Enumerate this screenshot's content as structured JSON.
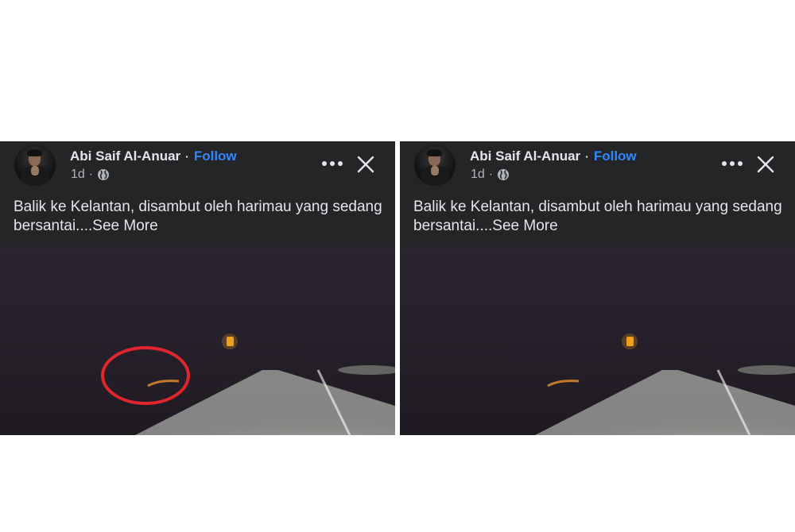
{
  "posts": [
    {
      "author": "Abi Saif Al-Anuar",
      "separator": "·",
      "follow_label": "Follow",
      "time": "1d",
      "meta_separator": "·",
      "privacy_icon": "globe-icon",
      "more_icon": "more-dots-icon",
      "close_icon": "close-icon",
      "caption": "Balik ke Kelantan, disambut oleh harimau yang sedang bersantai....",
      "see_more_label": "See More",
      "annotated": true
    },
    {
      "author": "Abi Saif Al-Anuar",
      "separator": "·",
      "follow_label": "Follow",
      "time": "1d",
      "meta_separator": "·",
      "privacy_icon": "globe-icon",
      "more_icon": "more-dots-icon",
      "close_icon": "close-icon",
      "caption": "Balik ke Kelantan, disambut oleh harimau yang sedang bersantai....",
      "see_more_label": "See More",
      "annotated": false
    }
  ],
  "colors": {
    "card_background": "#242526",
    "text_primary": "#e4e6eb",
    "text_secondary": "#b0b3b8",
    "follow_blue": "#2d88ff",
    "annotation_red": "#e0262c"
  }
}
